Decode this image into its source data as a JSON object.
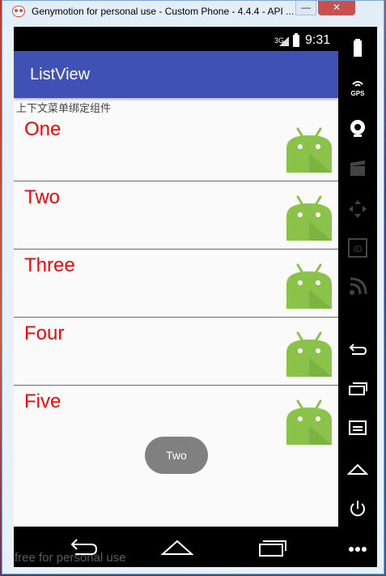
{
  "window": {
    "title": "Genymotion for personal use - Custom Phone - 4.4.4 - API ...",
    "minimize_label": "—",
    "close_label": "✕"
  },
  "statusbar": {
    "network": "3G",
    "time": "9:31"
  },
  "app": {
    "title": "ListView",
    "subtitle": "上下文菜单绑定组件",
    "accent_color": "#3f51b5",
    "item_text_color": "#ff0000"
  },
  "list": {
    "items": [
      {
        "label": "One",
        "icon": "android-robot-icon"
      },
      {
        "label": "Two",
        "icon": "android-robot-icon"
      },
      {
        "label": "Three",
        "icon": "android-robot-icon"
      },
      {
        "label": "Four",
        "icon": "android-robot-icon"
      },
      {
        "label": "Five",
        "icon": "android-robot-icon"
      }
    ]
  },
  "toast": {
    "text": "Two"
  },
  "navbar": {
    "icons": [
      "back-icon",
      "home-icon",
      "recents-icon"
    ]
  },
  "sidebar": {
    "icons": [
      "battery-icon",
      "gps-icon",
      "camera-icon",
      "clapper-icon",
      "dpad-icon",
      "id-icon",
      "rss-icon",
      "back-icon",
      "recents-icon",
      "menu-icon",
      "home-icon",
      "power-icon",
      "more-icon"
    ],
    "gps_label": "GPS",
    "id_label": "ID"
  },
  "watermark": "free for personal use"
}
